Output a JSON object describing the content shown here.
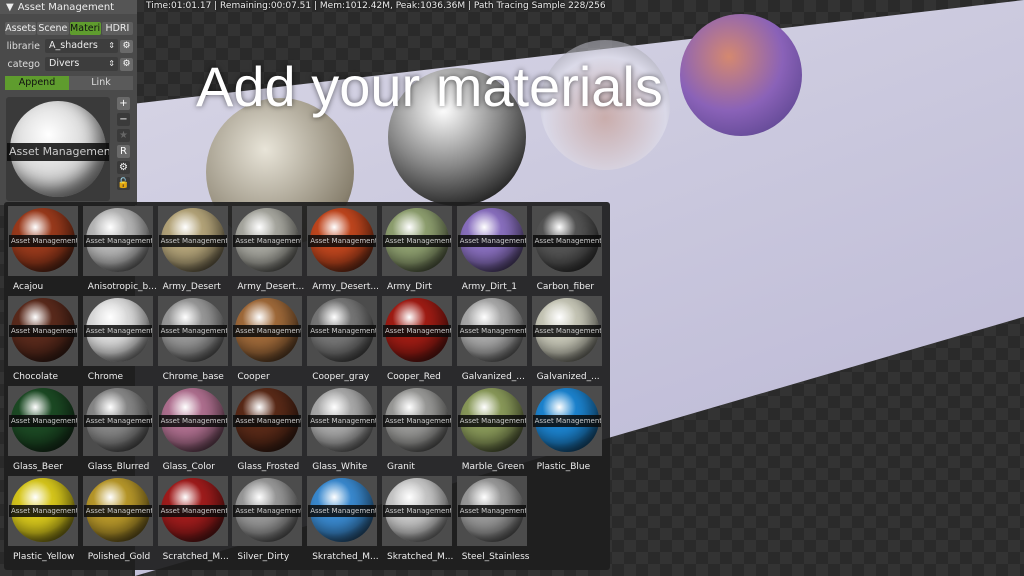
{
  "status": "Time:01:01.17 | Remaining:00:07.51 | Mem:1012.42M, Peak:1036.36M | Path Tracing Sample 228/256",
  "overlay_title": "Add your materials",
  "panel": {
    "title": "Asset Management",
    "tabs": [
      "Assets",
      "Scene",
      "Materi",
      "HDRI"
    ],
    "active_tab": "Materi",
    "library_label": "librarie",
    "library_value": "A_shaders",
    "category_label": "catego",
    "category_value": "Divers",
    "append": "Append",
    "link": "Link",
    "preview_band": "Asset Management",
    "tools": [
      "+",
      "−",
      "★",
      "R",
      "⚙",
      "🔓"
    ]
  },
  "band_text": "Asset Management",
  "accent": "#5f9c2e",
  "materials": [
    {
      "name": "Acajou",
      "color": "#9a3a1c"
    },
    {
      "name": "Anisotropic_b...",
      "color": "#b8b8b8"
    },
    {
      "name": "Army_Desert",
      "color": "#b5a57a"
    },
    {
      "name": "Army_Desert...",
      "color": "#a8a8a0"
    },
    {
      "name": "Army_Desert...",
      "color": "#c0461e"
    },
    {
      "name": "Army_Dirt",
      "color": "#8fa070"
    },
    {
      "name": "Army_Dirt_1",
      "color": "#8a70c0"
    },
    {
      "name": "Carbon_fiber",
      "color": "#555"
    },
    {
      "name": "Chocolate",
      "color": "#5a2a1c"
    },
    {
      "name": "Chrome",
      "color": "#ddd"
    },
    {
      "name": "Chrome_base",
      "color": "#999"
    },
    {
      "name": "Cooper",
      "color": "#a06a3a"
    },
    {
      "name": "Cooper_gray",
      "color": "#777"
    },
    {
      "name": "Cooper_Red",
      "color": "#a01c14"
    },
    {
      "name": "Galvanized_...",
      "color": "#aaa"
    },
    {
      "name": "Galvanized_...",
      "color": "#c8c8b8"
    },
    {
      "name": "Glass_Beer",
      "color": "#1c4a24"
    },
    {
      "name": "Glass_Blurred",
      "color": "#888"
    },
    {
      "name": "Glass_Color",
      "color": "#b07090"
    },
    {
      "name": "Glass_Frosted",
      "color": "#5a2a18"
    },
    {
      "name": "Glass_White",
      "color": "#aaa"
    },
    {
      "name": "Granit",
      "color": "#9a9a98"
    },
    {
      "name": "Marble_Green",
      "color": "#8a9a5a"
    },
    {
      "name": "Plastic_Blue",
      "color": "#1c84d0"
    },
    {
      "name": "Plastic_Yellow",
      "color": "#d8c81c"
    },
    {
      "name": "Polished_Gold",
      "color": "#b8982a"
    },
    {
      "name": "Scratched_M...",
      "color": "#a01c1c"
    },
    {
      "name": "Silver_Dirty",
      "color": "#999"
    },
    {
      "name": "Skratched_M...",
      "color": "#3a8ad0"
    },
    {
      "name": "Skratched_M...",
      "color": "#c8c8c8"
    },
    {
      "name": "Steel_Stainless",
      "color": "#9a9a9a"
    }
  ]
}
